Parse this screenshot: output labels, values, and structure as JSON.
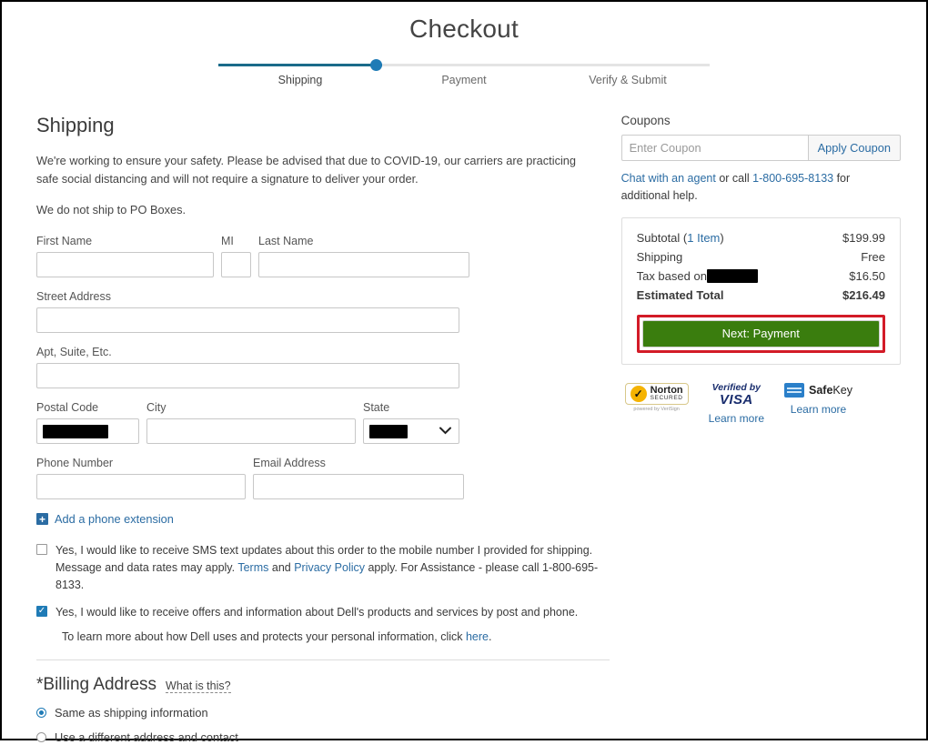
{
  "header": {
    "title": "Checkout",
    "steps": [
      {
        "label": "Shipping",
        "active": true
      },
      {
        "label": "Payment",
        "active": false
      },
      {
        "label": "Verify & Submit",
        "active": false
      }
    ]
  },
  "shipping": {
    "title": "Shipping",
    "covid_notice": "We're working to ensure your safety. Please be advised that due to COVID-19, our carriers are practicing safe social distancing and will not require a signature to deliver your order.",
    "po_box_notice": "We do not ship to PO Boxes.",
    "fields": {
      "first_name_label": "First Name",
      "first_name_value": "",
      "mi_label": "MI",
      "mi_value": "",
      "last_name_label": "Last Name",
      "last_name_value": "",
      "street_label": "Street Address",
      "street_value": "",
      "apt_label": "Apt, Suite, Etc.",
      "apt_value": "",
      "postal_label": "Postal Code",
      "postal_value": "",
      "city_label": "City",
      "city_value": "",
      "state_label": "State",
      "state_value": "",
      "phone_label": "Phone Number",
      "phone_value": "",
      "email_label": "Email Address",
      "email_value": ""
    },
    "add_extension_label": "Add a phone extension",
    "sms_consent": {
      "checked": false,
      "line1": "Yes, I would like to receive SMS text updates about this order to the mobile number I provided for shipping.",
      "line2_a": "Message and data rates may apply. ",
      "terms_link": "Terms",
      "line2_b": " and ",
      "privacy_link": "Privacy Policy",
      "line2_c": " apply. For Assistance - please call 1-800-695-8133."
    },
    "offers_consent": {
      "checked": true,
      "text": "Yes, I would like to receive offers and information about Dell's products and services by post and phone."
    },
    "privacy_note_a": "To learn more about how Dell uses and protects your personal information, click ",
    "privacy_note_link": "here",
    "privacy_note_b": "."
  },
  "billing": {
    "title": "*Billing Address",
    "what_is_this": "What is this?",
    "options": [
      {
        "label": "Same as shipping information",
        "selected": true
      },
      {
        "label": "Use a different address and contact",
        "selected": false
      }
    ]
  },
  "coupons": {
    "title": "Coupons",
    "placeholder": "Enter Coupon",
    "value": "",
    "apply_label": "Apply Coupon",
    "help_chat_link": "Chat with an agent",
    "help_mid": " or call ",
    "help_phone": "1-800-695-8133",
    "help_tail": " for additional help."
  },
  "summary": {
    "rows": [
      {
        "label": "Subtotal (",
        "link": "1 Item",
        "label_tail": ")",
        "value": "$199.99",
        "bold": false,
        "redacted": false
      },
      {
        "label": "Shipping",
        "value": "Free",
        "bold": false,
        "redacted": false
      },
      {
        "label": "Tax based on ",
        "value": "$16.50",
        "bold": false,
        "redacted": true
      },
      {
        "label": "Estimated Total",
        "value": "$216.49",
        "bold": true,
        "redacted": false
      }
    ],
    "next_button_label": "Next: Payment",
    "highlight_color": "#d31b27",
    "button_color": "#3a7d0e"
  },
  "badges": [
    {
      "name": "norton",
      "main": "Norton",
      "sub": "SECURED",
      "by": "powered by VeriSign",
      "learn_more": ""
    },
    {
      "name": "verified-by-visa",
      "top": "Verified by",
      "main": "VISA",
      "learn_more": "Learn more"
    },
    {
      "name": "safekey",
      "main_a": "Safe",
      "main_b": "Key",
      "learn_more": "Learn more"
    }
  ]
}
